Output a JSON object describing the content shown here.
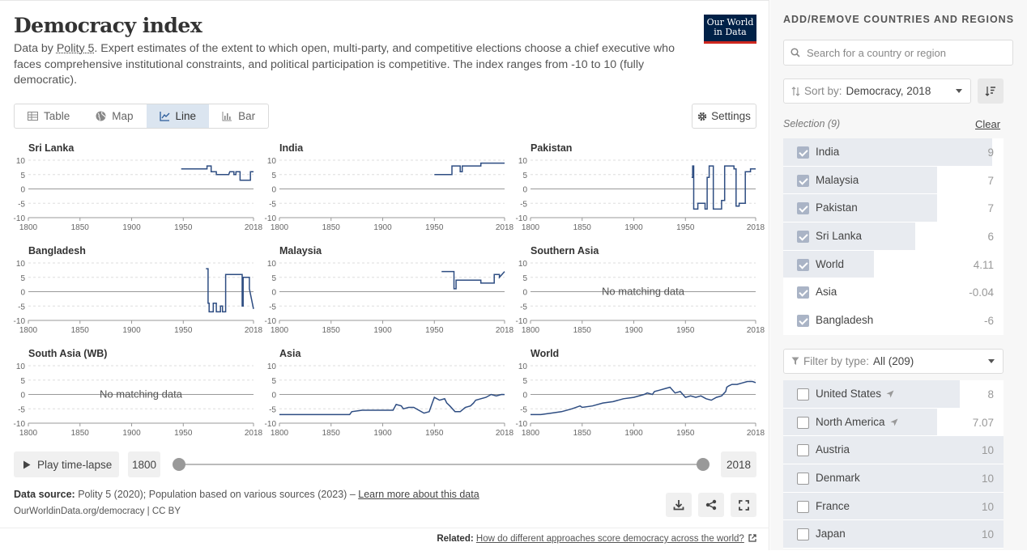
{
  "header": {
    "title": "Democracy index",
    "subtitle_pre": "Data by ",
    "subtitle_link": "Polity 5",
    "subtitle_post": ". Expert estimates of the extent to which open, multi-party, and competitive elections choose a chief executive who faces comprehensive institutional constraints, and political participation is competitive. The index ranges from -10 to 10 (fully democratic).",
    "logo_line1": "Our World",
    "logo_line2": "in Data"
  },
  "tabs": [
    {
      "label": "Table",
      "icon": "table-icon"
    },
    {
      "label": "Map",
      "icon": "globe-icon"
    },
    {
      "label": "Line",
      "icon": "line-chart-icon",
      "active": true
    },
    {
      "label": "Bar",
      "icon": "bar-chart-icon"
    }
  ],
  "settings_label": "Settings",
  "no_data_label": "No matching data",
  "chart_data": [
    {
      "type": "line",
      "title": "Sri Lanka",
      "ylim": [
        -10,
        10
      ],
      "xlim": [
        1800,
        2018
      ],
      "yticks": [
        10,
        5,
        0,
        -5,
        -10
      ],
      "xticks": [
        1800,
        1850,
        1900,
        1950,
        2018
      ],
      "x": [
        1948,
        1973,
        1973,
        1977,
        1977,
        1982,
        1982,
        1989,
        1989,
        1994,
        1994,
        1995,
        1995,
        1999,
        1999,
        2001,
        2001,
        2005,
        2005,
        2014,
        2014,
        2015,
        2015,
        2018
      ],
      "y": [
        7,
        7,
        8,
        8,
        6,
        6,
        5,
        5,
        5,
        5,
        5,
        6,
        6,
        6,
        5,
        5,
        6,
        6,
        3,
        3,
        3,
        3,
        6,
        6
      ]
    },
    {
      "type": "line",
      "title": "India",
      "ylim": [
        -10,
        10
      ],
      "xlim": [
        1800,
        2018
      ],
      "yticks": [
        10,
        5,
        0,
        -5,
        -10
      ],
      "xticks": [
        1800,
        1850,
        1900,
        1950,
        2018
      ],
      "x": [
        1950,
        1967,
        1967,
        1975,
        1975,
        1977,
        1977,
        1995,
        1995,
        2018
      ],
      "y": [
        5,
        5,
        8,
        8,
        6,
        6,
        8,
        8,
        9,
        9
      ]
    },
    {
      "type": "line",
      "title": "Pakistan",
      "ylim": [
        -10,
        10
      ],
      "xlim": [
        1800,
        2018
      ],
      "yticks": [
        10,
        5,
        0,
        -5,
        -10
      ],
      "xticks": [
        1800,
        1850,
        1900,
        1950,
        2018
      ],
      "x": [
        1956,
        1957,
        1957,
        1958,
        1958,
        1962,
        1962,
        1969,
        1969,
        1971,
        1971,
        1973,
        1973,
        1977,
        1977,
        1985,
        1985,
        1988,
        1988,
        1997,
        1997,
        1999,
        1999,
        2002,
        2002,
        2008,
        2008,
        2013,
        2013,
        2018
      ],
      "y": [
        4,
        4,
        8,
        8,
        -7,
        -7,
        -5,
        -5,
        -7,
        -7,
        4,
        4,
        8,
        8,
        -7,
        -7,
        -4,
        -4,
        8,
        8,
        7,
        7,
        -6,
        -6,
        -5,
        -5,
        6,
        6,
        7,
        7
      ]
    },
    {
      "type": "line",
      "title": "Bangladesh",
      "ylim": [
        -10,
        10
      ],
      "xlim": [
        1800,
        2018
      ],
      "yticks": [
        10,
        5,
        0,
        -5,
        -10
      ],
      "xticks": [
        1800,
        1850,
        1900,
        1950,
        2018
      ],
      "x": [
        1972,
        1974,
        1974,
        1975,
        1975,
        1979,
        1979,
        1982,
        1982,
        1986,
        1986,
        1988,
        1988,
        1991,
        1991,
        2007,
        2007,
        2008,
        2008,
        2014,
        2014,
        2018
      ],
      "y": [
        8,
        8,
        -4,
        -4,
        -7,
        -7,
        -4,
        -4,
        -7,
        -7,
        -5,
        -5,
        -7,
        -7,
        6,
        6,
        -5,
        -5,
        5,
        5,
        1,
        -6
      ]
    },
    {
      "type": "line",
      "title": "Malaysia",
      "ylim": [
        -10,
        10
      ],
      "xlim": [
        1800,
        2018
      ],
      "yticks": [
        10,
        5,
        0,
        -5,
        -10
      ],
      "xticks": [
        1800,
        1850,
        1900,
        1950,
        2018
      ],
      "x": [
        1957,
        1969,
        1969,
        1971,
        1971,
        1995,
        1995,
        2008,
        2008,
        2013,
        2013,
        2018
      ],
      "y": [
        7,
        7,
        1,
        1,
        4,
        4,
        3,
        3,
        6,
        6,
        5,
        7
      ]
    },
    {
      "type": "line",
      "title": "Southern Asia",
      "ylim": [
        -10,
        10
      ],
      "xlim": [
        1800,
        2018
      ],
      "yticks": [
        10,
        5,
        0,
        -5,
        -10
      ],
      "xticks": [
        1800,
        1850,
        1900,
        1950,
        2018
      ],
      "x": [],
      "y": []
    },
    {
      "type": "line",
      "title": "South Asia (WB)",
      "ylim": [
        -10,
        10
      ],
      "xlim": [
        1800,
        2018
      ],
      "yticks": [
        10,
        5,
        0,
        -5,
        -10
      ],
      "xticks": [
        1800,
        1850,
        1900,
        1950,
        2018
      ],
      "x": [],
      "y": []
    },
    {
      "type": "line",
      "title": "Asia",
      "ylim": [
        -10,
        10
      ],
      "xlim": [
        1800,
        2018
      ],
      "yticks": [
        10,
        5,
        0,
        -5,
        -10
      ],
      "xticks": [
        1800,
        1850,
        1900,
        1950,
        2018
      ],
      "x": [
        1800,
        1830,
        1850,
        1868,
        1870,
        1880,
        1890,
        1900,
        1905,
        1910,
        1913,
        1918,
        1920,
        1925,
        1930,
        1940,
        1945,
        1948,
        1950,
        1955,
        1960,
        1962,
        1965,
        1970,
        1975,
        1980,
        1985,
        1988,
        1990,
        1995,
        2000,
        2005,
        2010,
        2015,
        2018
      ],
      "y": [
        -7,
        -7,
        -7,
        -7,
        -6,
        -5.5,
        -5.5,
        -5.5,
        -5.5,
        -5.5,
        -3.5,
        -4,
        -5,
        -4.5,
        -4.5,
        -6.5,
        -6,
        -3,
        -1,
        -2,
        -1.5,
        -3,
        -4,
        -6,
        -6,
        -4.5,
        -4,
        -3,
        -2,
        -1.5,
        -1,
        0,
        -0.5,
        0,
        -0.04
      ]
    },
    {
      "type": "line",
      "title": "World",
      "ylim": [
        -10,
        10
      ],
      "xlim": [
        1800,
        2018
      ],
      "yticks": [
        10,
        5,
        0,
        -5,
        -10
      ],
      "xticks": [
        1800,
        1850,
        1900,
        1950,
        2018
      ],
      "x": [
        1800,
        1810,
        1820,
        1830,
        1840,
        1848,
        1850,
        1860,
        1870,
        1880,
        1890,
        1900,
        1910,
        1913,
        1918,
        1920,
        1925,
        1930,
        1935,
        1940,
        1945,
        1950,
        1955,
        1960,
        1965,
        1970,
        1975,
        1980,
        1985,
        1989,
        1990,
        1992,
        1995,
        2000,
        2005,
        2010,
        2015,
        2018
      ],
      "y": [
        -7,
        -7,
        -6.5,
        -6,
        -5,
        -4,
        -4.5,
        -4,
        -3,
        -2.5,
        -1.5,
        -1,
        0,
        0.5,
        0,
        1,
        1.5,
        2,
        2.5,
        0.5,
        1,
        -1,
        -0.5,
        -1,
        -0.5,
        -1.5,
        -2,
        -1,
        -0.5,
        1,
        2.5,
        3,
        3.5,
        3.5,
        4,
        4.5,
        4.5,
        4.11
      ]
    }
  ],
  "timeline": {
    "play_label": "Play time-lapse",
    "start_year": "1800",
    "end_year": "2018"
  },
  "footer": {
    "source_label": "Data source:",
    "source_text": " Polity 5 (2020); Population based on various sources (2023) – ",
    "learn_more": "Learn more about this data",
    "license": "OurWorldinData.org/democracy | CC BY",
    "related_label": "Related:",
    "related_link": "How do different approaches score democracy across the world?"
  },
  "sidebar": {
    "heading": "ADD/REMOVE COUNTRIES AND REGIONS",
    "search_placeholder": "Search for a country or region",
    "sort_label": "Sort by:",
    "sort_value": "Democracy, 2018",
    "selection_label": "Selection (9)",
    "clear_label": "Clear",
    "selected": [
      {
        "name": "India",
        "value": "9",
        "bar": 0.95
      },
      {
        "name": "Malaysia",
        "value": "7",
        "bar": 0.7
      },
      {
        "name": "Pakistan",
        "value": "7",
        "bar": 0.7
      },
      {
        "name": "Sri Lanka",
        "value": "6",
        "bar": 0.6
      },
      {
        "name": "World",
        "value": "4.11",
        "bar": 0.41
      },
      {
        "name": "Asia",
        "value": "-0.04",
        "bar": 0
      },
      {
        "name": "Bangladesh",
        "value": "-6",
        "bar": 0
      }
    ],
    "filter_label": "Filter by type:",
    "filter_value": "All (209)",
    "others": [
      {
        "name": "United States",
        "value": "8",
        "bar": 0.8,
        "arrow": true
      },
      {
        "name": "North America",
        "value": "7.07",
        "bar": 0.7,
        "arrow": true
      },
      {
        "name": "Austria",
        "value": "10",
        "bar": 1.0
      },
      {
        "name": "Denmark",
        "value": "10",
        "bar": 1.0
      },
      {
        "name": "France",
        "value": "10",
        "bar": 1.0
      },
      {
        "name": "Japan",
        "value": "10",
        "bar": 1.0
      }
    ]
  }
}
